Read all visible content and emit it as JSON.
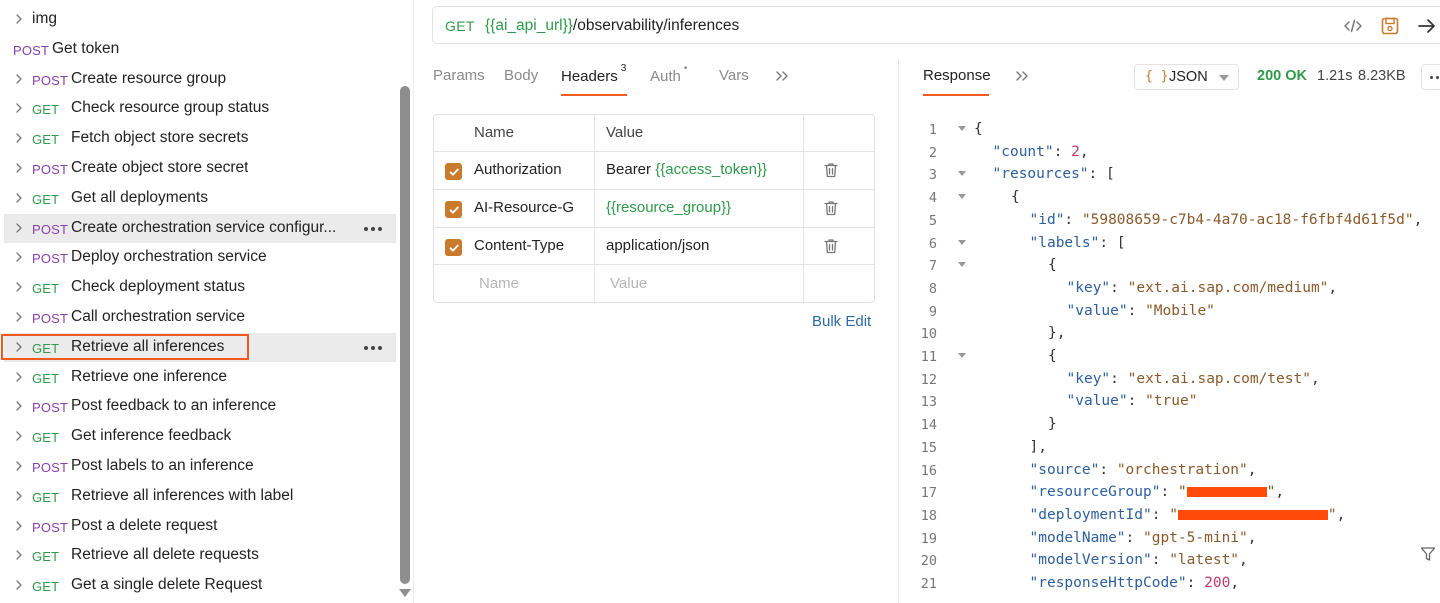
{
  "sidebar": {
    "items": [
      {
        "method": "",
        "name": "img",
        "kind": "folder",
        "chevron": true
      },
      {
        "method": "POST",
        "name": "Get token",
        "kind": "root",
        "chevron": false
      },
      {
        "method": "POST",
        "name": "Create resource group",
        "kind": "item",
        "chevron": true
      },
      {
        "method": "GET",
        "name": "Check resource group status",
        "kind": "item",
        "chevron": true
      },
      {
        "method": "GET",
        "name": "Fetch object store secrets",
        "kind": "item",
        "chevron": true
      },
      {
        "method": "POST",
        "name": "Create object store secret",
        "kind": "item",
        "chevron": true
      },
      {
        "method": "GET",
        "name": "Get all deployments",
        "kind": "item",
        "chevron": true
      },
      {
        "method": "POST",
        "name": "Create orchestration service configur...",
        "kind": "item",
        "chevron": true,
        "highlight": true,
        "more": true
      },
      {
        "method": "POST",
        "name": "Deploy orchestration service",
        "kind": "item",
        "chevron": true
      },
      {
        "method": "GET",
        "name": "Check deployment status",
        "kind": "item",
        "chevron": true
      },
      {
        "method": "POST",
        "name": "Call orchestration service",
        "kind": "item",
        "chevron": true
      },
      {
        "method": "GET",
        "name": "Retrieve all inferences",
        "kind": "item",
        "chevron": true,
        "highlight": true,
        "more": true,
        "selected": true
      },
      {
        "method": "GET",
        "name": "Retrieve one inference",
        "kind": "item",
        "chevron": true
      },
      {
        "method": "POST",
        "name": "Post feedback to an inference",
        "kind": "item",
        "chevron": true
      },
      {
        "method": "GET",
        "name": "Get inference feedback",
        "kind": "item",
        "chevron": true
      },
      {
        "method": "POST",
        "name": "Post labels to an inference",
        "kind": "item",
        "chevron": true
      },
      {
        "method": "GET",
        "name": "Retrieve all inferences with label",
        "kind": "item",
        "chevron": true
      },
      {
        "method": "POST",
        "name": "Post a delete request",
        "kind": "item",
        "chevron": true
      },
      {
        "method": "GET",
        "name": "Retrieve all delete requests",
        "kind": "item",
        "chevron": true
      },
      {
        "method": "GET",
        "name": "Get a single delete Request",
        "kind": "item",
        "chevron": true
      }
    ]
  },
  "urlbar": {
    "method": "GET",
    "url_var": "{{ai_api_url}}",
    "url_path": "/observability/inferences"
  },
  "request_tabs": {
    "params": "Params",
    "body": "Body",
    "headers": "Headers",
    "headers_count": "3",
    "auth": "Auth",
    "auth_dot": "•",
    "vars": "Vars"
  },
  "headers_table": {
    "col_name": "Name",
    "col_value": "Value",
    "rows": [
      {
        "name": "Authorization",
        "value_prefix": "Bearer ",
        "value_var": "{{access_token}}",
        "value_plain": ""
      },
      {
        "name": "AI-Resource-G",
        "value_prefix": "",
        "value_var": "{{resource_group}}",
        "value_plain": ""
      },
      {
        "name": "Content-Type",
        "value_prefix": "",
        "value_var": "",
        "value_plain": "application/json"
      }
    ],
    "placeholder_name": "Name",
    "placeholder_value": "Value",
    "bulk_edit": "Bulk Edit"
  },
  "response": {
    "tab": "Response",
    "format_braces": "{ }",
    "format": "JSON",
    "status": "200 OK",
    "time": "1.21s",
    "size": "8.23KB"
  },
  "json_lines": [
    {
      "n": "1",
      "fold": true,
      "indent": 0,
      "parts": [
        [
          "p",
          "{"
        ]
      ]
    },
    {
      "n": "2",
      "fold": false,
      "indent": 1,
      "parts": [
        [
          "k",
          "\"count\""
        ],
        [
          "p",
          ": "
        ],
        [
          "n",
          "2"
        ],
        [
          "p",
          ","
        ]
      ]
    },
    {
      "n": "3",
      "fold": true,
      "indent": 1,
      "parts": [
        [
          "k",
          "\"resources\""
        ],
        [
          "p",
          ": ["
        ]
      ]
    },
    {
      "n": "4",
      "fold": true,
      "indent": 2,
      "parts": [
        [
          "p",
          "{"
        ]
      ]
    },
    {
      "n": "5",
      "fold": false,
      "indent": 3,
      "parts": [
        [
          "k",
          "\"id\""
        ],
        [
          "p",
          ": "
        ],
        [
          "s",
          "\"59808659-c7b4-4a70-ac18-f6fbf4d61f5d\""
        ],
        [
          "p",
          ","
        ]
      ]
    },
    {
      "n": "6",
      "fold": true,
      "indent": 3,
      "parts": [
        [
          "k",
          "\"labels\""
        ],
        [
          "p",
          ": ["
        ]
      ]
    },
    {
      "n": "7",
      "fold": true,
      "indent": 4,
      "parts": [
        [
          "p",
          "{"
        ]
      ]
    },
    {
      "n": "8",
      "fold": false,
      "indent": 5,
      "parts": [
        [
          "k",
          "\"key\""
        ],
        [
          "p",
          ": "
        ],
        [
          "s",
          "\"ext.ai.sap.com/medium\""
        ],
        [
          "p",
          ","
        ]
      ]
    },
    {
      "n": "9",
      "fold": false,
      "indent": 5,
      "parts": [
        [
          "k",
          "\"value\""
        ],
        [
          "p",
          ": "
        ],
        [
          "s",
          "\"Mobile\""
        ]
      ]
    },
    {
      "n": "10",
      "fold": false,
      "indent": 4,
      "parts": [
        [
          "p",
          "},"
        ]
      ]
    },
    {
      "n": "11",
      "fold": true,
      "indent": 4,
      "parts": [
        [
          "p",
          "{"
        ]
      ]
    },
    {
      "n": "12",
      "fold": false,
      "indent": 5,
      "parts": [
        [
          "k",
          "\"key\""
        ],
        [
          "p",
          ": "
        ],
        [
          "s",
          "\"ext.ai.sap.com/test\""
        ],
        [
          "p",
          ","
        ]
      ]
    },
    {
      "n": "13",
      "fold": false,
      "indent": 5,
      "parts": [
        [
          "k",
          "\"value\""
        ],
        [
          "p",
          ": "
        ],
        [
          "s",
          "\"true\""
        ]
      ]
    },
    {
      "n": "14",
      "fold": false,
      "indent": 4,
      "parts": [
        [
          "p",
          "}"
        ]
      ]
    },
    {
      "n": "15",
      "fold": false,
      "indent": 3,
      "parts": [
        [
          "p",
          "],"
        ]
      ]
    },
    {
      "n": "16",
      "fold": false,
      "indent": 3,
      "parts": [
        [
          "k",
          "\"source\""
        ],
        [
          "p",
          ": "
        ],
        [
          "s",
          "\"orchestration\""
        ],
        [
          "p",
          ","
        ]
      ]
    },
    {
      "n": "17",
      "fold": false,
      "indent": 3,
      "parts": [
        [
          "k",
          "\"resourceGroup\""
        ],
        [
          "p",
          ": "
        ],
        [
          "s",
          "\""
        ],
        [
          "r",
          "80"
        ],
        [
          "s",
          "\""
        ],
        [
          "p",
          ","
        ]
      ]
    },
    {
      "n": "18",
      "fold": false,
      "indent": 3,
      "parts": [
        [
          "k",
          "\"deploymentId\""
        ],
        [
          "p",
          ": "
        ],
        [
          "s",
          "\""
        ],
        [
          "r",
          "150"
        ],
        [
          "s",
          "\""
        ],
        [
          "p",
          ","
        ]
      ]
    },
    {
      "n": "19",
      "fold": false,
      "indent": 3,
      "parts": [
        [
          "k",
          "\"modelName\""
        ],
        [
          "p",
          ": "
        ],
        [
          "s",
          "\"gpt-5-mini\""
        ],
        [
          "p",
          ","
        ]
      ]
    },
    {
      "n": "20",
      "fold": false,
      "indent": 3,
      "parts": [
        [
          "k",
          "\"modelVersion\""
        ],
        [
          "p",
          ": "
        ],
        [
          "s",
          "\"latest\""
        ],
        [
          "p",
          ","
        ]
      ]
    },
    {
      "n": "21",
      "fold": false,
      "indent": 3,
      "parts": [
        [
          "k",
          "\"responseHttpCode\""
        ],
        [
          "p",
          ": "
        ],
        [
          "n",
          "200"
        ],
        [
          "p",
          ","
        ]
      ]
    }
  ]
}
